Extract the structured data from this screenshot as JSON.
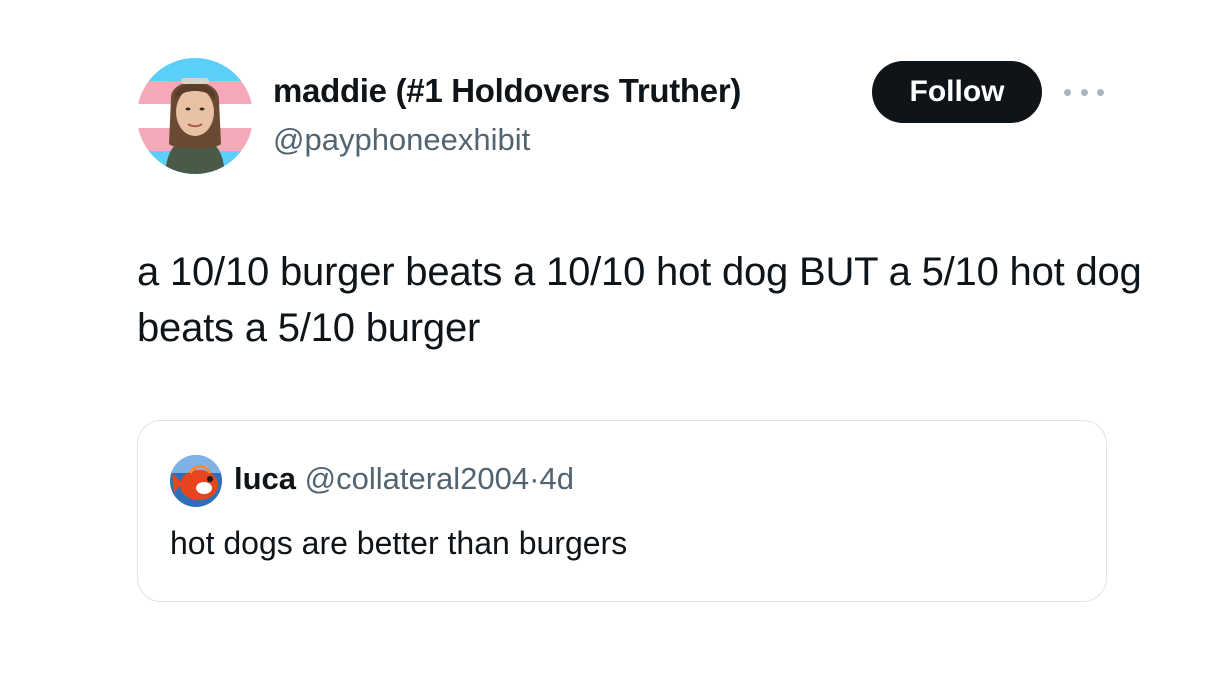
{
  "tweet": {
    "author": {
      "display_name": "maddie (#1 Holdovers Truther)",
      "handle": "@payphoneexhibit",
      "avatar_flag_colors": [
        "#5bcefa",
        "#f5a9b8",
        "#ffffff"
      ]
    },
    "follow_label": "Follow",
    "more_icon": "ellipsis-icon",
    "text": "a 10/10 burger beats a 10/10 hot dog BUT a 5/10 hot dog beats a 5/10 burger"
  },
  "quote": {
    "display_name": "luca",
    "handle": "@collateral2004",
    "separator": "·",
    "time": "4d",
    "text": "hot dogs are better than burgers"
  },
  "colors": {
    "text_primary": "#0f1419",
    "text_secondary": "#536471",
    "follow_bg": "#0f1419",
    "card_border": "#dfe4e8"
  }
}
